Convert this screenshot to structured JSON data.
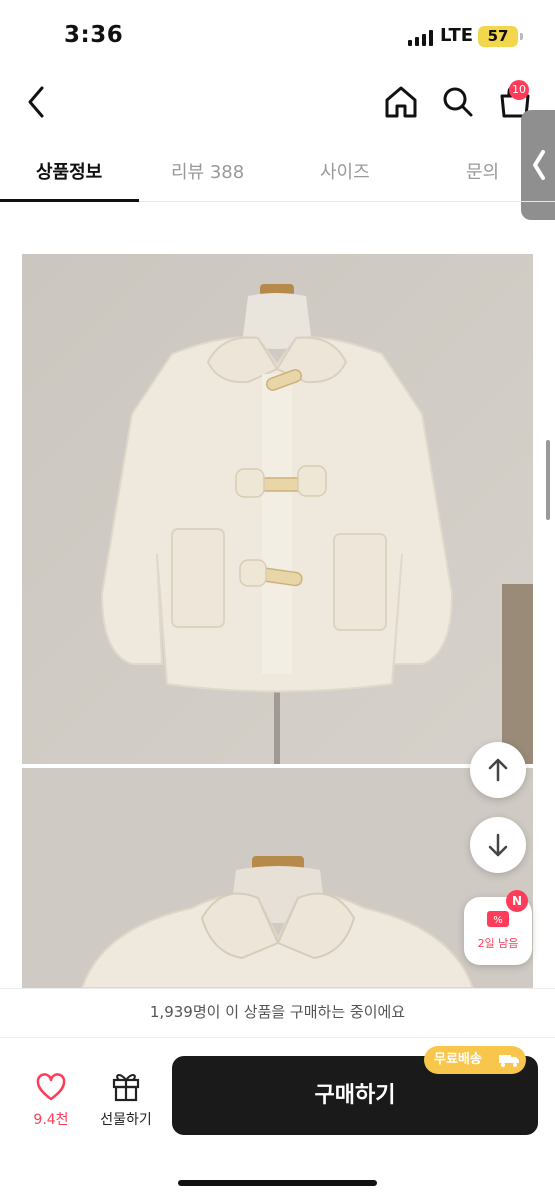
{
  "status": {
    "time": "3:36",
    "network": "LTE",
    "battery": "57"
  },
  "header": {
    "cart_badge": "10"
  },
  "tabs": [
    {
      "label": "상품정보",
      "active": true
    },
    {
      "label": "리뷰 388",
      "active": false
    },
    {
      "label": "사이즈",
      "active": false
    },
    {
      "label": "문의",
      "active": false
    }
  ],
  "coupon": {
    "badge": "N",
    "label": "2일 남음"
  },
  "bottom_bar": {
    "buyers_text": "1,939명이 이 상품을 구매하는 중이에요",
    "like_count": "9.4천",
    "gift_label": "선물하기",
    "buy_label": "구매하기",
    "shipping_badge": "무료배송"
  },
  "colors": {
    "accent": "#ff3d5a",
    "buy_button": "#1a1a1a",
    "shipping_badge": "#f7c64a"
  }
}
